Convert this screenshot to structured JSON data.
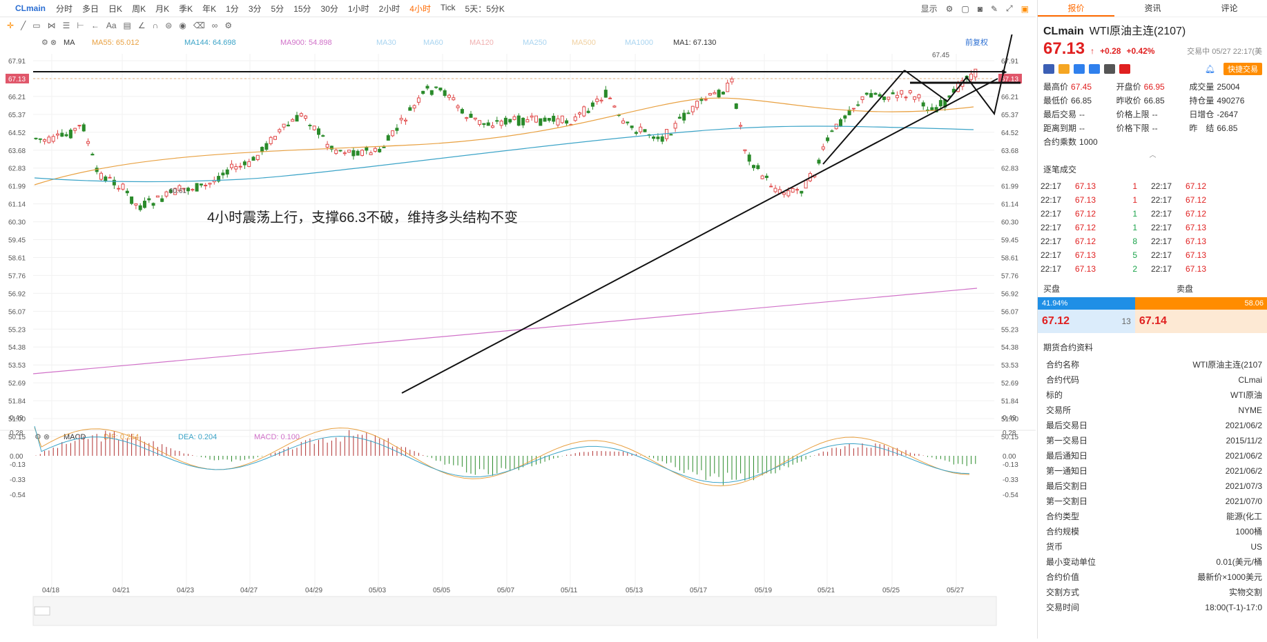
{
  "topbar": {
    "symbol": "CLmain",
    "timeframes": [
      "分时",
      "多日",
      "日K",
      "周K",
      "月K",
      "季K",
      "年K",
      "1分",
      "3分",
      "5分",
      "15分",
      "30分",
      "1小时",
      "2小时",
      "4小时",
      "Tick",
      "5天：5分K"
    ],
    "active_timeframe": "4小时",
    "display_label": "显示"
  },
  "ma_bar": {
    "label": "MA",
    "items": [
      {
        "text": "MA55: 65.012",
        "color": "#e8a040"
      },
      {
        "text": "MA144: 64.698",
        "color": "#3aa3c7"
      },
      {
        "text": "MA900: 54.898",
        "color": "#d070c8"
      },
      {
        "text": "MA30",
        "color": "#a8d4f0"
      },
      {
        "text": "MA60",
        "color": "#a8d4f0"
      },
      {
        "text": "MA120",
        "color": "#f0b0b0"
      },
      {
        "text": "MA250",
        "color": "#a8d4f0"
      },
      {
        "text": "MA500",
        "color": "#f0d0a0"
      },
      {
        "text": "MA1000",
        "color": "#a8d4f0"
      },
      {
        "text": "MA1: 67.130",
        "color": "#333333"
      }
    ],
    "adjust_label": "前复权"
  },
  "macd_bar": {
    "label": "MACD",
    "items": [
      {
        "text": "DIF: 0.254",
        "color": "#e8a040"
      },
      {
        "text": "DEA: 0.204",
        "color": "#3aa3c7"
      },
      {
        "text": "MACD: 0.100",
        "color": "#d070c8"
      }
    ]
  },
  "chart": {
    "annotation": "4小时震荡上行，支撑66.3不破，维持多头结构不变",
    "high_label": "67.45",
    "low_label": "60.61",
    "price_ticks": [
      "67.91",
      "67.13",
      "66.21",
      "65.37",
      "64.52",
      "63.68",
      "62.83",
      "61.99",
      "61.14",
      "60.30",
      "59.45",
      "58.61",
      "57.76",
      "56.92",
      "56.07",
      "55.23",
      "54.38",
      "53.53",
      "52.69",
      "51.84",
      "51.00",
      "50.15"
    ],
    "macd_ticks": [
      "0.49",
      "0.28",
      "0.00",
      "-0.13",
      "-0.33",
      "-0.54"
    ],
    "date_ticks": [
      "04/18",
      "04/21",
      "04/23",
      "04/27",
      "04/29",
      "05/03",
      "05/05",
      "05/07",
      "05/11",
      "05/13",
      "05/17",
      "05/19",
      "05/21",
      "05/25",
      "05/27"
    ],
    "year_label": "2021"
  },
  "panel": {
    "tabs": [
      "报价",
      "资讯",
      "评论"
    ],
    "symbol": "CLmain",
    "name": "WTI原油主连(2107)",
    "price": "67.13",
    "change": "+0.28",
    "change_pct": "+0.42%",
    "status": "交易中 05/27 22:17(美",
    "quick_trade": "快捷交易",
    "stats": [
      {
        "label": "最高价",
        "value": "67.45",
        "cls": "red"
      },
      {
        "label": "开盘价",
        "value": "66.95",
        "cls": "red"
      },
      {
        "label": "成交量",
        "value": "25004",
        "cls": ""
      },
      {
        "label": "最低价",
        "value": "66.85",
        "cls": ""
      },
      {
        "label": "昨收价",
        "value": "66.85",
        "cls": ""
      },
      {
        "label": "持仓量",
        "value": "490276",
        "cls": ""
      },
      {
        "label": "最后交易",
        "value": "--",
        "cls": ""
      },
      {
        "label": "价格上限",
        "value": "--",
        "cls": ""
      },
      {
        "label": "日增仓",
        "value": "-2647",
        "cls": ""
      },
      {
        "label": "距离到期",
        "value": "--",
        "cls": ""
      },
      {
        "label": "价格下限",
        "value": "--",
        "cls": ""
      },
      {
        "label": "昨　结",
        "value": "66.85",
        "cls": ""
      },
      {
        "label": "合约乘数",
        "value": "1000",
        "cls": ""
      }
    ],
    "ticks_title": "逐笔成交",
    "ticks": [
      {
        "t1": "22:17",
        "p1": "67.13",
        "v1": "1",
        "t2": "22:17",
        "p2": "67.12"
      },
      {
        "t1": "22:17",
        "p1": "67.13",
        "v1": "1",
        "t2": "22:17",
        "p2": "67.12"
      },
      {
        "t1": "22:17",
        "p1": "67.12",
        "v1": "1",
        "t2": "22:17",
        "p2": "67.12"
      },
      {
        "t1": "22:17",
        "p1": "67.12",
        "v1": "1",
        "t2": "22:17",
        "p2": "67.13"
      },
      {
        "t1": "22:17",
        "p1": "67.12",
        "v1": "8",
        "t2": "22:17",
        "p2": "67.13"
      },
      {
        "t1": "22:17",
        "p1": "67.13",
        "v1": "5",
        "t2": "22:17",
        "p2": "67.13"
      },
      {
        "t1": "22:17",
        "p1": "67.13",
        "v1": "2",
        "t2": "22:17",
        "p2": "67.13"
      }
    ],
    "buy_label": "买盘",
    "sell_label": "卖盘",
    "buy_pct": "41.94%",
    "sell_pct": "58.06",
    "bid": "67.12",
    "bid_qty": "13",
    "ask": "67.14",
    "contract_title": "期货合约资料",
    "contract": [
      {
        "k": "合约名称",
        "v": "WTI原油主连(2107"
      },
      {
        "k": "合约代码",
        "v": "CLmai"
      },
      {
        "k": "标的",
        "v": "WTI原油"
      },
      {
        "k": "交易所",
        "v": "NYME"
      },
      {
        "k": "最后交易日",
        "v": "2021/06/2"
      },
      {
        "k": "第一交易日",
        "v": "2015/11/2"
      },
      {
        "k": "最后通知日",
        "v": "2021/06/2"
      },
      {
        "k": "第一通知日",
        "v": "2021/06/2"
      },
      {
        "k": "最后交割日",
        "v": "2021/07/3"
      },
      {
        "k": "第一交割日",
        "v": "2021/07/0"
      },
      {
        "k": "合约类型",
        "v": "能源(化工"
      },
      {
        "k": "合约规模",
        "v": "1000桶"
      },
      {
        "k": "货币",
        "v": "US"
      },
      {
        "k": "最小变动单位",
        "v": "0.01(美元/桶"
      },
      {
        "k": "合约价值",
        "v": "最新价×1000美元"
      },
      {
        "k": "交割方式",
        "v": "实物交割"
      },
      {
        "k": "交易时间",
        "v": "18:00(T-1)-17:0"
      }
    ]
  }
}
